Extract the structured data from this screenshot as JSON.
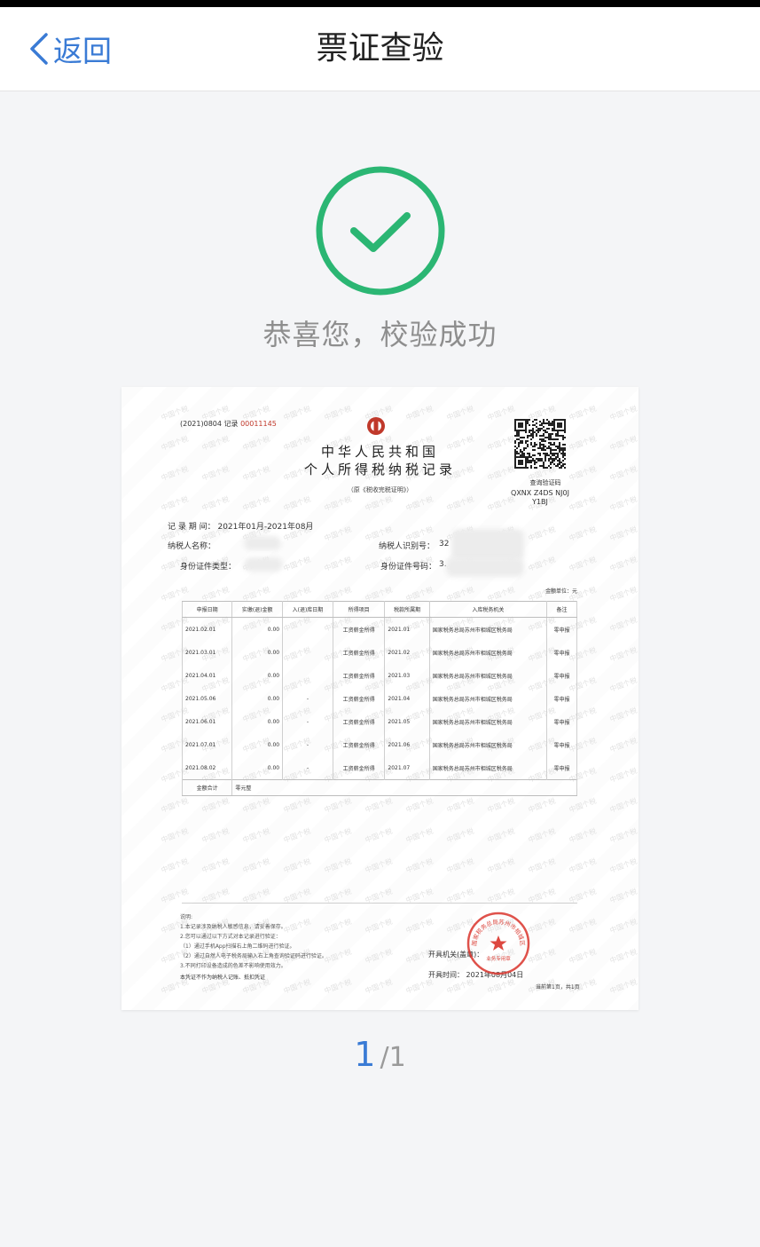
{
  "nav": {
    "back_label": "返回",
    "title": "票证查验"
  },
  "result": {
    "message": "恭喜您，校验成功",
    "success_color": "#2bb673"
  },
  "document": {
    "record_prefix": "(2021)0804  记录",
    "record_number": "00011145",
    "title_line1": "中华人民共和国",
    "title_line2": "个人所得税纳税记录",
    "subtitle": "（原《税收完税证明》）",
    "qr_label": "查询验证码",
    "qr_code": "QXNX Z4DS NJ0J Y1BJ",
    "record_period_label": "记 录 期 间：",
    "record_period_value": "2021年01月-2021年08月",
    "taxpayer_name_label": "纳税人名称：",
    "taxpayer_id_label": "纳税人识别号：",
    "id_type_label": "身份证件类型：",
    "id_number_label": "身份证件号码：",
    "taxpayer_id_partial": "32",
    "id_number_partial": "3.",
    "unit_note": "金额单位：元",
    "table_headers": [
      "申报日期",
      "实缴(退)金额",
      "入(退)库日期",
      "所得项目",
      "税款所属期",
      "入库税务机关",
      "备注"
    ],
    "rows": [
      {
        "date": "2021.02.01",
        "amount": "0.00",
        "stock_date": "",
        "item": "工资薪金所得",
        "period": "2021.01",
        "office": "国家税务总局苏州市相城区税务局",
        "note": "零申报"
      },
      {
        "date": "2021.03.01",
        "amount": "0.00",
        "stock_date": "",
        "item": "工资薪金所得",
        "period": "2021.02",
        "office": "国家税务总局苏州市相城区税务局",
        "note": "零申报"
      },
      {
        "date": "2021.04.01",
        "amount": "0.00",
        "stock_date": "",
        "item": "工资薪金所得",
        "period": "2021.03",
        "office": "国家税务总局苏州市相城区税务局",
        "note": "零申报"
      },
      {
        "date": "2021.05.06",
        "amount": "0.00",
        "stock_date": "-",
        "item": "工资薪金所得",
        "period": "2021.04",
        "office": "国家税务总局苏州市相城区税务局",
        "note": "零申报"
      },
      {
        "date": "2021.06.01",
        "amount": "0.00",
        "stock_date": "-",
        "item": "工资薪金所得",
        "period": "2021.05",
        "office": "国家税务总局苏州市相城区税务局",
        "note": "零申报"
      },
      {
        "date": "2021.07.01",
        "amount": "0.00",
        "stock_date": "-",
        "item": "工资薪金所得",
        "period": "2021.06",
        "office": "国家税务总局苏州市相城区税务局",
        "note": "零申报"
      },
      {
        "date": "2021.08.02",
        "amount": "0.00",
        "stock_date": "-",
        "item": "工资薪金所得",
        "period": "2021.07",
        "office": "国家税务总局苏州市相城区税务局",
        "note": "零申报"
      }
    ],
    "total_label": "金额合计",
    "total_value": "零元整",
    "notes_title": "说明:",
    "notes": [
      "1.本记录涉及纳税人敏感信息，请妥善保存。",
      "2.您可以通过以下方式对本记录进行验证：",
      "（1）通过手机App扫描右上角二维码进行验证。",
      "（2）通过自然人电子税务局输入右上角查询验证码进行验证。",
      "3.不同打印设备造成的色差不影响使用效力。"
    ],
    "footer_note": "本凭证不作为纳税人记账、抵扣凭证",
    "issuer_label": "开具机关(盖章)：",
    "issue_time_label": "开具时间：",
    "issue_time_value": "2021年08月04日",
    "page_info": "当前第1页，共1页",
    "seal_text": "国家税务总局苏州市相城区税务局",
    "seal_sub": "业务专用章",
    "seal_color": "#d9342b",
    "watermark": "中国个税"
  },
  "pager": {
    "current": "1",
    "total": "/1",
    "accent": "#3a7bd5"
  }
}
